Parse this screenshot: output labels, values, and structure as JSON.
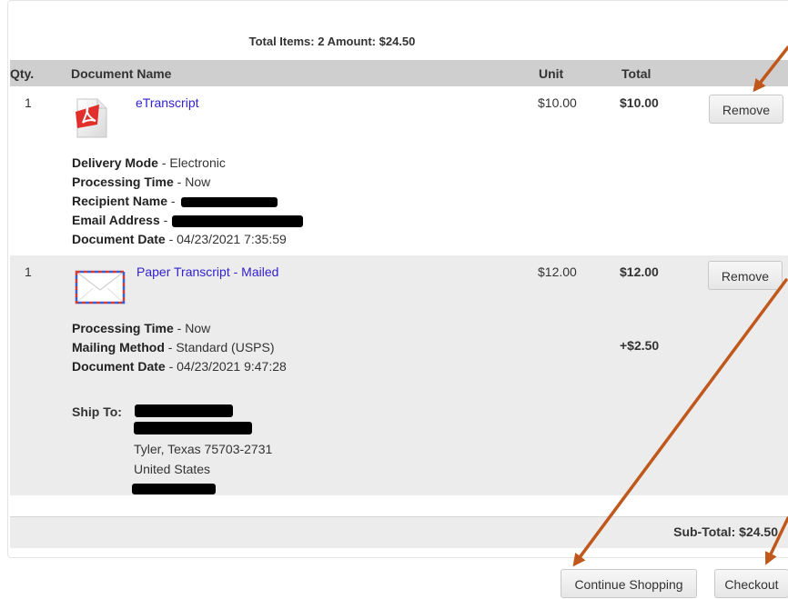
{
  "cart": {
    "summary": "Total Items: 2  Amount: $24.50",
    "columns": {
      "qty": "Qty.",
      "document": "Document Name",
      "unit": "Unit",
      "total": "Total"
    },
    "items": [
      {
        "qty": "1",
        "name": "eTranscript",
        "unit": "$10.00",
        "total": "$10.00",
        "remove_label": "Remove",
        "icon": "pdf-document-icon",
        "details": [
          {
            "label": "Delivery Mode",
            "sep": " - ",
            "value": "Electronic"
          },
          {
            "label": "Processing Time",
            "sep": " - ",
            "value": "Now"
          },
          {
            "label": "Recipient Name",
            "sep": " - ",
            "value": ""
          },
          {
            "label": "Email Address",
            "sep": " - ",
            "value": ""
          },
          {
            "label": "Document Date",
            "sep": " - ",
            "value": "04/23/2021 7:35:59"
          }
        ]
      },
      {
        "qty": "1",
        "name": "Paper Transcript - Mailed",
        "unit": "$12.00",
        "total": "$12.00",
        "remove_label": "Remove",
        "icon": "airmail-envelope-icon",
        "details": [
          {
            "label": "Processing Time",
            "sep": " - ",
            "value": "Now"
          },
          {
            "label": "Mailing Method",
            "sep": " - ",
            "value": "Standard (USPS)"
          },
          {
            "label": "Document Date",
            "sep": " - ",
            "value": "04/23/2021 9:47:28"
          }
        ],
        "mailing_fee": "+$2.50",
        "ship_to_label": "Ship To:",
        "address_city": "Tyler, Texas 75703-2731",
        "address_country": "United States"
      }
    ],
    "subtotal": "Sub-Total: $24.50",
    "continue_label": "Continue Shopping",
    "checkout_label": "Checkout"
  },
  "colors": {
    "header_bg": "#cfcfcf",
    "alt_row_bg": "#ececec",
    "link": "#3322cc",
    "annotation_arrow": "#c0581c",
    "redaction": "#000000"
  }
}
